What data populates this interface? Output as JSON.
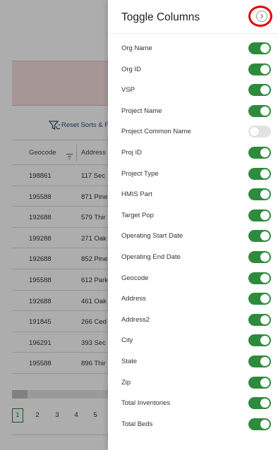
{
  "drawer": {
    "title": "Toggle Columns",
    "close_icon": "chevron-right-circle-icon",
    "highlight_color": "#e00000",
    "toggle_on_color": "#2e8b3e",
    "columns": [
      {
        "label": "Org Name",
        "enabled": true
      },
      {
        "label": "Org ID",
        "enabled": true
      },
      {
        "label": "VSP",
        "enabled": true
      },
      {
        "label": "Project Name",
        "enabled": true
      },
      {
        "label": "Project Common Name",
        "enabled": false
      },
      {
        "label": "Proj ID",
        "enabled": true
      },
      {
        "label": "Project Type",
        "enabled": true
      },
      {
        "label": "HMIS Part",
        "enabled": true
      },
      {
        "label": "Target Pop",
        "enabled": true
      },
      {
        "label": "Operating Start Date",
        "enabled": true
      },
      {
        "label": "Operating End Date",
        "enabled": true
      },
      {
        "label": "Geocode",
        "enabled": true
      },
      {
        "label": "Address",
        "enabled": true
      },
      {
        "label": "Address2",
        "enabled": true
      },
      {
        "label": "City",
        "enabled": true
      },
      {
        "label": "State",
        "enabled": true
      },
      {
        "label": "Zip",
        "enabled": true
      },
      {
        "label": "Total Inventories",
        "enabled": true
      },
      {
        "label": "Total Beds",
        "enabled": true
      }
    ]
  },
  "background": {
    "reset_label": "Reset Sorts & F",
    "reset_icon": "reset-filter-icon",
    "table": {
      "headers": [
        "Geocode",
        "Address"
      ],
      "rows": [
        [
          "198861",
          "117 Sec"
        ],
        [
          "195588",
          "871 Pine"
        ],
        [
          "192688",
          "579 Thir"
        ],
        [
          "199288",
          "271 Oak"
        ],
        [
          "192688",
          "852 Pine"
        ],
        [
          "195588",
          "612 Park"
        ],
        [
          "192688",
          "461 Oak"
        ],
        [
          "191845",
          "266 Ced"
        ],
        [
          "196291",
          "393 Sec"
        ],
        [
          "195588",
          "896 Thir"
        ]
      ]
    },
    "pagination": [
      "1",
      "2",
      "3",
      "4",
      "5"
    ],
    "active_page": "1"
  }
}
